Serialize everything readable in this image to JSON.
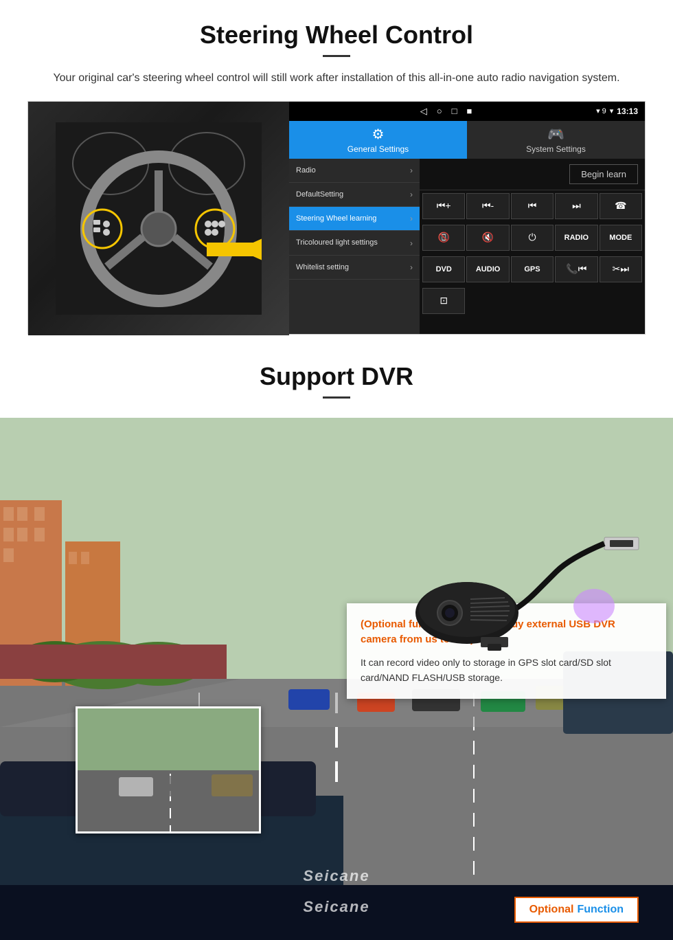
{
  "steering": {
    "title": "Steering Wheel Control",
    "subtitle": "Your original car's steering wheel control will still work after installation of this all-in-one auto radio navigation system.",
    "statusBar": {
      "time": "13:13",
      "icons": [
        "◁",
        "○",
        "□",
        "■"
      ]
    },
    "tabs": {
      "general": {
        "label": "General Settings",
        "icon": "⚙"
      },
      "system": {
        "label": "System Settings",
        "icon": "🎮"
      }
    },
    "menuItems": [
      {
        "label": "Radio",
        "active": false
      },
      {
        "label": "DefaultSetting",
        "active": false
      },
      {
        "label": "Steering Wheel learning",
        "active": true
      },
      {
        "label": "Tricoloured light settings",
        "active": false
      },
      {
        "label": "Whitelist setting",
        "active": false
      }
    ],
    "beginLearn": "Begin learn",
    "controlButtons": {
      "row1": [
        "⏮+",
        "⏮-",
        "⏮",
        "⏭",
        "📞"
      ],
      "row2": [
        "📵",
        "🔇",
        "⏻",
        "RADIO",
        "MODE"
      ],
      "row3": [
        "DVD",
        "AUDIO",
        "GPS",
        "📞⏮",
        "✂⏭"
      ]
    }
  },
  "dvr": {
    "title": "Support DVR",
    "optionalText": "(Optional function, require to buy external USB DVR camera from us to use)",
    "descText": "It can record video only to storage in GPS slot card/SD slot card/NAND FLASH/USB storage.",
    "optionalBadge": {
      "optional": "Optional",
      "function": "Function"
    }
  },
  "watermark": "Seicane"
}
